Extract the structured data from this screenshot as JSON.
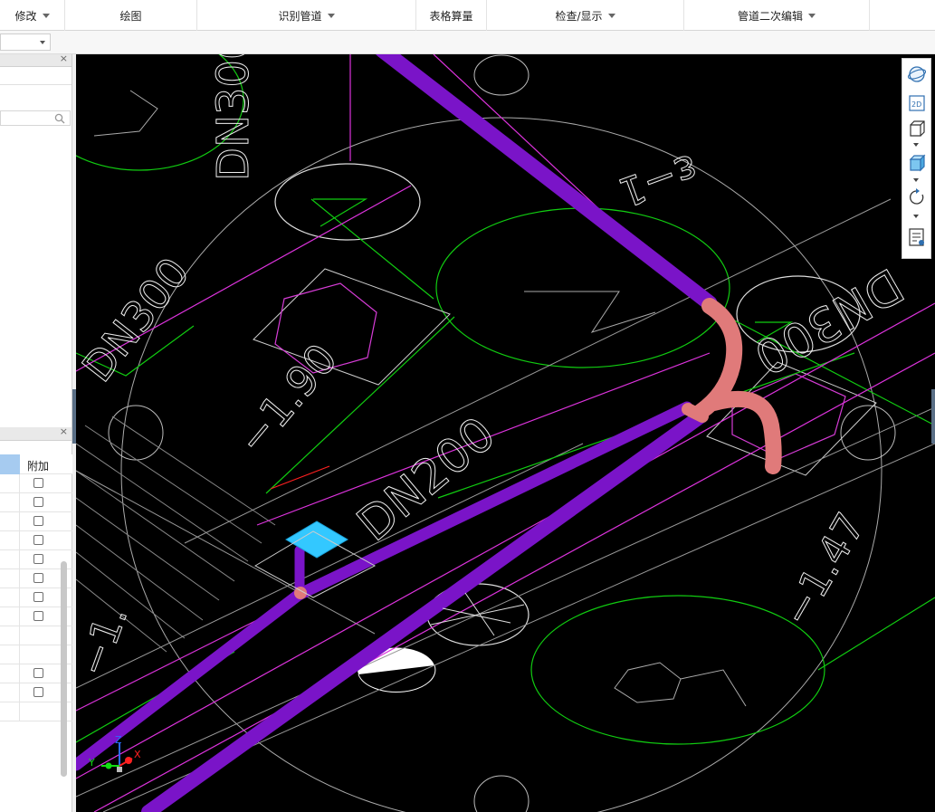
{
  "ribbon": {
    "groups": [
      {
        "label": "修改",
        "dropdown": true
      },
      {
        "label": "绘图",
        "dropdown": false
      },
      {
        "label": "识别管道",
        "dropdown": true
      },
      {
        "label": "表格算量",
        "dropdown": false
      },
      {
        "label": "检查/显示",
        "dropdown": true
      },
      {
        "label": "管道二次编辑",
        "dropdown": true
      }
    ]
  },
  "property_grid": {
    "header_label": "附加",
    "rows_checkbox": [
      true,
      true,
      true,
      true,
      true,
      true,
      true,
      true,
      false,
      false,
      true,
      true,
      false
    ]
  },
  "canvas_labels": {
    "dn300": "DN300",
    "dn300b": "DN300",
    "dn200": "DN200",
    "dn300c": "DN300",
    "elev1": "−1.90",
    "elev2": "−1.47",
    "elev3": "−1.",
    "side": "ε−1"
  },
  "view_tools": [
    "orbit-icon",
    "2d-view-icon",
    "wireframe-box-icon",
    "shaded-box-icon",
    "rotate-icon",
    "display-settings-icon"
  ],
  "axis_labels": {
    "x": "X",
    "y": "Y",
    "z": "Z"
  },
  "colors": {
    "pipe": "#7a14c8",
    "fitting": "#e07a7a",
    "green_line": "#11cc11",
    "magenta_line": "#dd33dd",
    "grey_line": "#bdbdbd",
    "marker": "#33c8ff"
  }
}
